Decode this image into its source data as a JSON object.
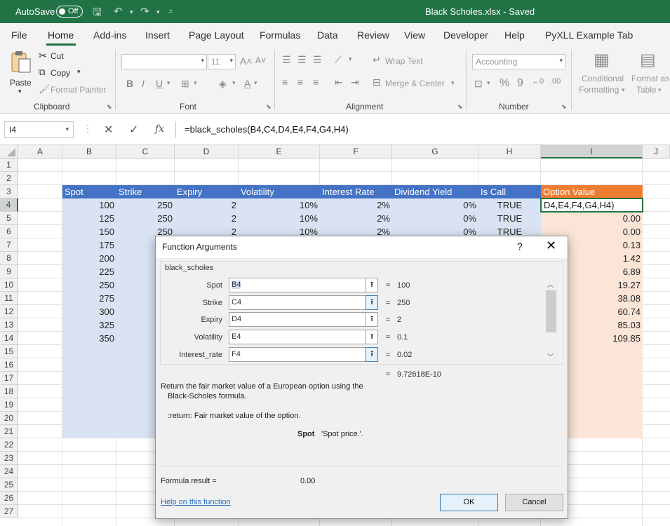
{
  "titlebar": {
    "autosave_label": "AutoSave",
    "autosave_state": "Off",
    "doc_title": "Black Scholes.xlsx  -  Saved"
  },
  "tabs": [
    "File",
    "Home",
    "Add-ins",
    "Insert",
    "Page Layout",
    "Formulas",
    "Data",
    "Review",
    "View",
    "Developer",
    "Help",
    "PyXLL Example Tab"
  ],
  "active_tab": "Home",
  "ribbon": {
    "clipboard": {
      "paste": "Paste",
      "cut": "Cut",
      "copy": "Copy",
      "format_painter": "Format Painter",
      "label": "Clipboard"
    },
    "font": {
      "font_name": "",
      "font_size": "11",
      "bold": "B",
      "italic": "I",
      "underline": "U",
      "label": "Font"
    },
    "alignment": {
      "wrap_text": "Wrap Text",
      "merge_center": "Merge & Center",
      "label": "Alignment"
    },
    "number": {
      "format": "Accounting",
      "label": "Number"
    },
    "styles": {
      "conditional_1": "Conditional",
      "conditional_2": "Formatting",
      "format_as_1": "Format as",
      "format_as_2": "Table"
    }
  },
  "formula_bar": {
    "name_box": "I4",
    "formula": "=black_scholes(B4,C4,D4,E4,F4,G4,H4)"
  },
  "sheet": {
    "columns": [
      "A",
      "B",
      "C",
      "D",
      "E",
      "F",
      "G",
      "H",
      "I",
      "J"
    ],
    "rows": [
      "1",
      "2",
      "3",
      "4",
      "5",
      "6",
      "7",
      "8",
      "9",
      "10",
      "11",
      "12",
      "13",
      "14",
      "15",
      "16",
      "17",
      "18",
      "19",
      "20",
      "21",
      "22",
      "23",
      "24",
      "25",
      "26",
      "27"
    ],
    "headers": [
      "Spot",
      "Strike",
      "Expiry",
      "Volatility",
      "Interest Rate",
      "Dividend Yield",
      "Is Call",
      "Option Value"
    ],
    "data": [
      [
        "100",
        "250",
        "2",
        "10%",
        "2%",
        "0%",
        "TRUE",
        "D4,E4,F4,G4,H4)"
      ],
      [
        "125",
        "250",
        "2",
        "10%",
        "2%",
        "0%",
        "TRUE",
        "0.00"
      ],
      [
        "150",
        "250",
        "2",
        "10%",
        "2%",
        "0%",
        "TRUE",
        "0.00"
      ],
      [
        "175",
        "",
        "",
        "",
        "",
        "",
        "",
        "0.13"
      ],
      [
        "200",
        "",
        "",
        "",
        "",
        "",
        "",
        "1.42"
      ],
      [
        "225",
        "",
        "",
        "",
        "",
        "",
        "",
        "6.89"
      ],
      [
        "250",
        "",
        "",
        "",
        "",
        "",
        "",
        "19.27"
      ],
      [
        "275",
        "",
        "",
        "",
        "",
        "",
        "",
        "38.08"
      ],
      [
        "300",
        "",
        "",
        "",
        "",
        "",
        "",
        "60.74"
      ],
      [
        "325",
        "",
        "",
        "",
        "",
        "",
        "",
        "85.03"
      ],
      [
        "350",
        "",
        "",
        "",
        "",
        "",
        "",
        "109.85"
      ]
    ],
    "colors": {
      "header_blue": "#4472c4",
      "header_orange": "#ed7d31",
      "input_fill": "#dae3f3",
      "output_fill": "#fbe5d6",
      "accent": "#217346"
    }
  },
  "dialog": {
    "title": "Function Arguments",
    "help_glyph": "?",
    "close_glyph": "✕",
    "function_name": "black_scholes",
    "args": [
      {
        "label": "Spot",
        "value": "B4",
        "result": "100"
      },
      {
        "label": "Strike",
        "value": "C4",
        "result": "250"
      },
      {
        "label": "Expiry",
        "value": "D4",
        "result": "2"
      },
      {
        "label": "Volatility",
        "value": "E4",
        "result": "0.1"
      },
      {
        "label": "Interest_rate",
        "value": "F4",
        "result": "0.02"
      }
    ],
    "eq_sign": "=",
    "function_result": "9.72618E-10",
    "description_line1": "Return the fair market value of a European option using the",
    "description_line2": "Black-Scholes formula.",
    "return_text": ":return: Fair market value of the option.",
    "arg_help_name": "Spot",
    "arg_help_text": "'Spot price.'.",
    "formula_result_label": "Formula result =",
    "formula_result_value": "0.00",
    "help_link": "Help on this function",
    "ok": "OK",
    "cancel": "Cancel"
  }
}
